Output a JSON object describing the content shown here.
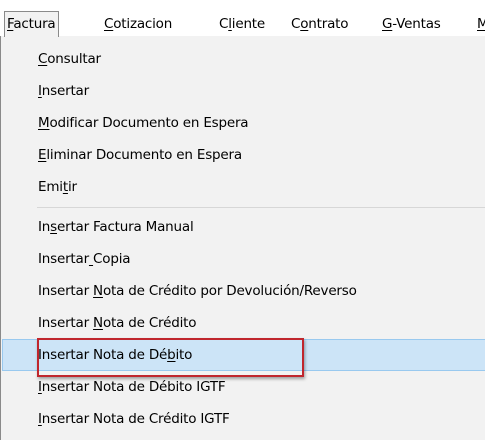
{
  "menubar": {
    "items": [
      {
        "pre": "",
        "key": "F",
        "post": "actura",
        "active": true
      },
      {
        "pre": "",
        "key": "C",
        "post": "otizacion"
      },
      {
        "pre": "C",
        "key": "l",
        "post": "iente"
      },
      {
        "pre": "C",
        "key": "o",
        "post": "ntrato"
      },
      {
        "pre": "",
        "key": "G",
        "post": "-Ventas"
      },
      {
        "pre": "",
        "key": "M",
        "post": ""
      }
    ]
  },
  "menu": {
    "items": [
      {
        "pre": "",
        "key": "C",
        "post": "onsultar"
      },
      {
        "pre": "",
        "key": "I",
        "post": "nsertar"
      },
      {
        "pre": "",
        "key": "M",
        "post": "odificar Documento en Espera"
      },
      {
        "pre": "",
        "key": "E",
        "post": "liminar Documento en Espera"
      },
      {
        "pre": "Emi",
        "key": "t",
        "post": "ir"
      },
      {
        "pre": "In",
        "key": "s",
        "post": "ertar Factura Manual"
      },
      {
        "pre": "Insertar",
        "key": " ",
        "post": "Copia"
      },
      {
        "pre": "Insertar ",
        "key": "N",
        "post": "ota de Crédito por Devolución/Reverso"
      },
      {
        "pre": "Insertar ",
        "key": "N",
        "post": "ota de Crédito"
      },
      {
        "pre": "Insertar Nota de Dé",
        "key": "b",
        "post": "ito",
        "highlighted": true
      },
      {
        "pre": "",
        "key": "I",
        "post": "nsertar Nota de Débito IGTF"
      },
      {
        "pre": "",
        "key": "I",
        "post": "nsertar Nota de Crédito IGTF"
      }
    ]
  },
  "colors": {
    "highlight": "#cce4f7",
    "annotation": "#c0262d"
  }
}
